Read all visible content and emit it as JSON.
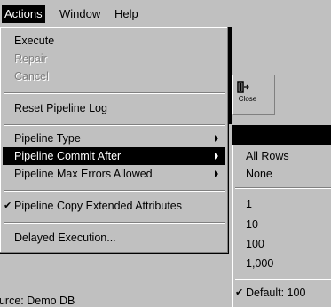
{
  "menubar": {
    "actions": "Actions",
    "window": "Window",
    "help": "Help"
  },
  "toolbar": {
    "close_label": "Close"
  },
  "actions_menu": {
    "execute": "Execute",
    "repair": "Repair",
    "cancel": "Cancel",
    "reset_pipeline_log": "Reset Pipeline Log",
    "pipeline_type": "Pipeline Type",
    "pipeline_commit_after": "Pipeline Commit After",
    "pipeline_max_errors": "Pipeline Max Errors Allowed",
    "pipeline_copy_extended": "Pipeline Copy Extended Attributes",
    "delayed_execution": "Delayed Execution..."
  },
  "commit_submenu": {
    "all_rows": "All Rows",
    "none": "None",
    "opt_1": "1",
    "opt_10": "10",
    "opt_100": "100",
    "opt_1000": "1,000",
    "default": "Default: 100"
  },
  "status": {
    "source": "ource: Demo DB"
  }
}
